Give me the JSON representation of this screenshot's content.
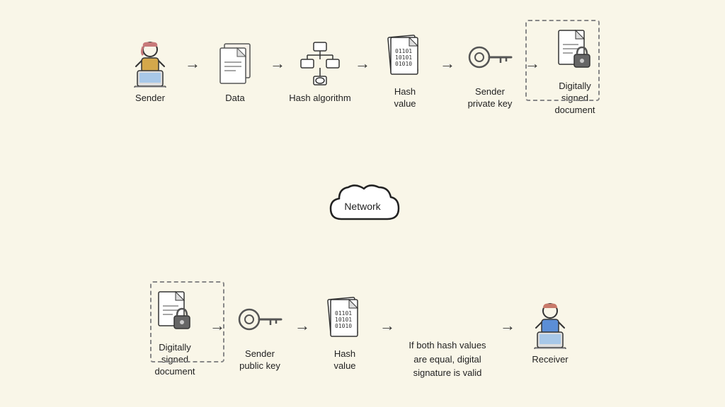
{
  "top_row": [
    {
      "id": "sender",
      "label": "Sender",
      "icon": "person"
    },
    {
      "id": "data",
      "label": "Data",
      "icon": "document"
    },
    {
      "id": "hash-algorithm",
      "label": "Hash algorithm",
      "icon": "flowchart"
    },
    {
      "id": "hash-value-top",
      "label": "Hash\nvalue",
      "icon": "hash-doc"
    },
    {
      "id": "sender-private-key",
      "label": "Sender\nprivate key",
      "icon": "key"
    },
    {
      "id": "digitally-signed-doc-top",
      "label": "Digitally\nsigned\ndocument",
      "icon": "locked-doc"
    }
  ],
  "network": {
    "label": "Network",
    "icon": "cloud"
  },
  "bottom_row": [
    {
      "id": "digitally-signed-doc-bottom",
      "label": "Digitally\nsigned\ndocument",
      "icon": "locked-doc"
    },
    {
      "id": "sender-public-key",
      "label": "Sender\npublic key",
      "icon": "key"
    },
    {
      "id": "hash-value-bottom",
      "label": "Hash\nvalue",
      "icon": "hash-doc"
    },
    {
      "id": "validation",
      "label": "If both hash values\nare equal, digital\nsignature is valid",
      "icon": "none"
    },
    {
      "id": "receiver",
      "label": "Receiver",
      "icon": "person2"
    }
  ],
  "arrows": "→"
}
